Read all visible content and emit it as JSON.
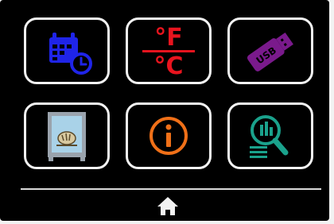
{
  "colors": {
    "calendar": "#1f24e8",
    "temperature": "#e8141e",
    "usb": "#7a1a8c",
    "oven_frame": "#9aa3ad",
    "oven_glass": "#a9d2e8",
    "info": "#f07018",
    "report": "#1aa28c",
    "tile_border": "#f2f2f2",
    "background": "#000000"
  },
  "tiles": [
    {
      "icon": "calendar-clock-icon"
    },
    {
      "icon": "temperature-unit-icon",
      "top_text": "°F",
      "bottom_text": "°C"
    },
    {
      "icon": "usb-drive-icon",
      "text": "USB"
    },
    {
      "icon": "oven-bread-icon"
    },
    {
      "icon": "info-icon",
      "text": "i"
    },
    {
      "icon": "report-search-icon"
    }
  ],
  "footer": {
    "icon": "home-icon"
  }
}
